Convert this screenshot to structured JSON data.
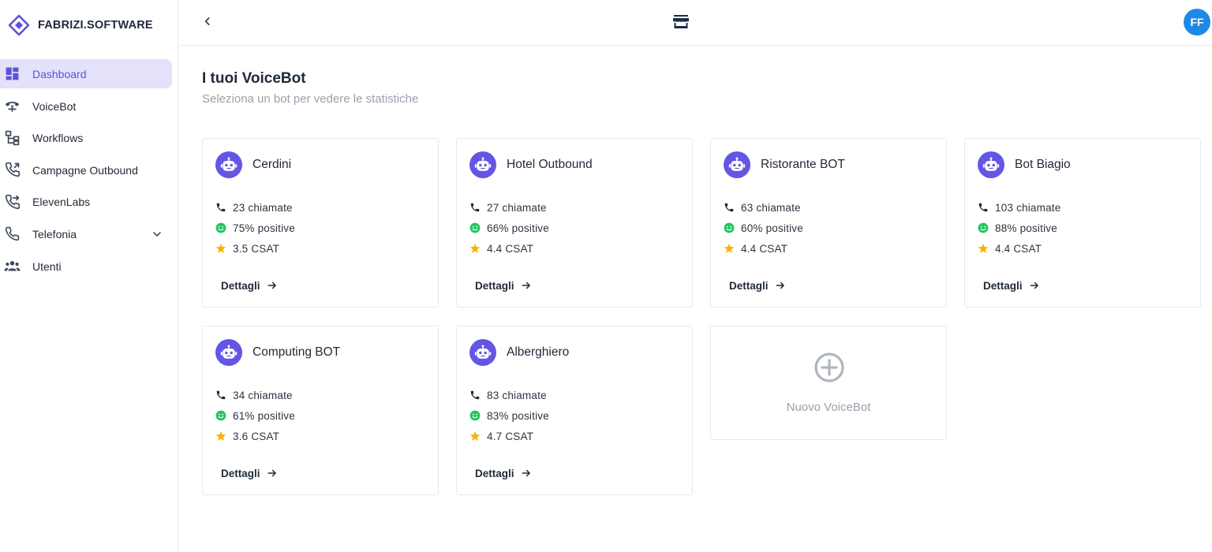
{
  "brand": {
    "name": "FABRIZI.SOFTWARE"
  },
  "sidebar": {
    "items": [
      {
        "label": "Dashboard",
        "icon": "dashboard-icon",
        "active": true
      },
      {
        "label": "VoiceBot",
        "icon": "voip-phone-icon"
      },
      {
        "label": "Workflows",
        "icon": "workflow-tree-icon"
      },
      {
        "label": "Campagne Outbound",
        "icon": "outbound-call-icon"
      },
      {
        "label": "ElevenLabs",
        "icon": "phone-forward-icon"
      },
      {
        "label": "Telefonia",
        "icon": "phone-icon",
        "expandable": true
      },
      {
        "label": "Utenti",
        "icon": "users-icon"
      }
    ]
  },
  "topbar": {
    "avatar_initials": "FF",
    "center_icon": "storefront-icon"
  },
  "main": {
    "title": "I tuoi VoiceBot",
    "subtitle": "Seleziona un bot per vedere le statistiche",
    "details_label": "Dettagli",
    "bots": [
      {
        "name": "Cerdini",
        "calls": "23 chiamate",
        "positive": "75% positive",
        "csat": "3.5 CSAT"
      },
      {
        "name": "Hotel Outbound",
        "calls": "27 chiamate",
        "positive": "66% positive",
        "csat": "4.4 CSAT"
      },
      {
        "name": "Ristorante BOT",
        "calls": "63 chiamate",
        "positive": "60% positive",
        "csat": "4.4 CSAT"
      },
      {
        "name": "Bot Biagio",
        "calls": "103 chiamate",
        "positive": "88% positive",
        "csat": "4.4 CSAT"
      },
      {
        "name": "Computing BOT",
        "calls": "34 chiamate",
        "positive": "61% positive",
        "csat": "3.6 CSAT"
      },
      {
        "name": "Alberghiero",
        "calls": "83 chiamate",
        "positive": "83% positive",
        "csat": "4.7 CSAT"
      }
    ],
    "new_bot_label": "Nuovo VoiceBot"
  },
  "colors": {
    "accent": "#6356e5",
    "active_nav_bg": "#e4e1fb",
    "positive": "#22c55e",
    "star": "#f5b60a",
    "avatar": "#1e88e5"
  }
}
